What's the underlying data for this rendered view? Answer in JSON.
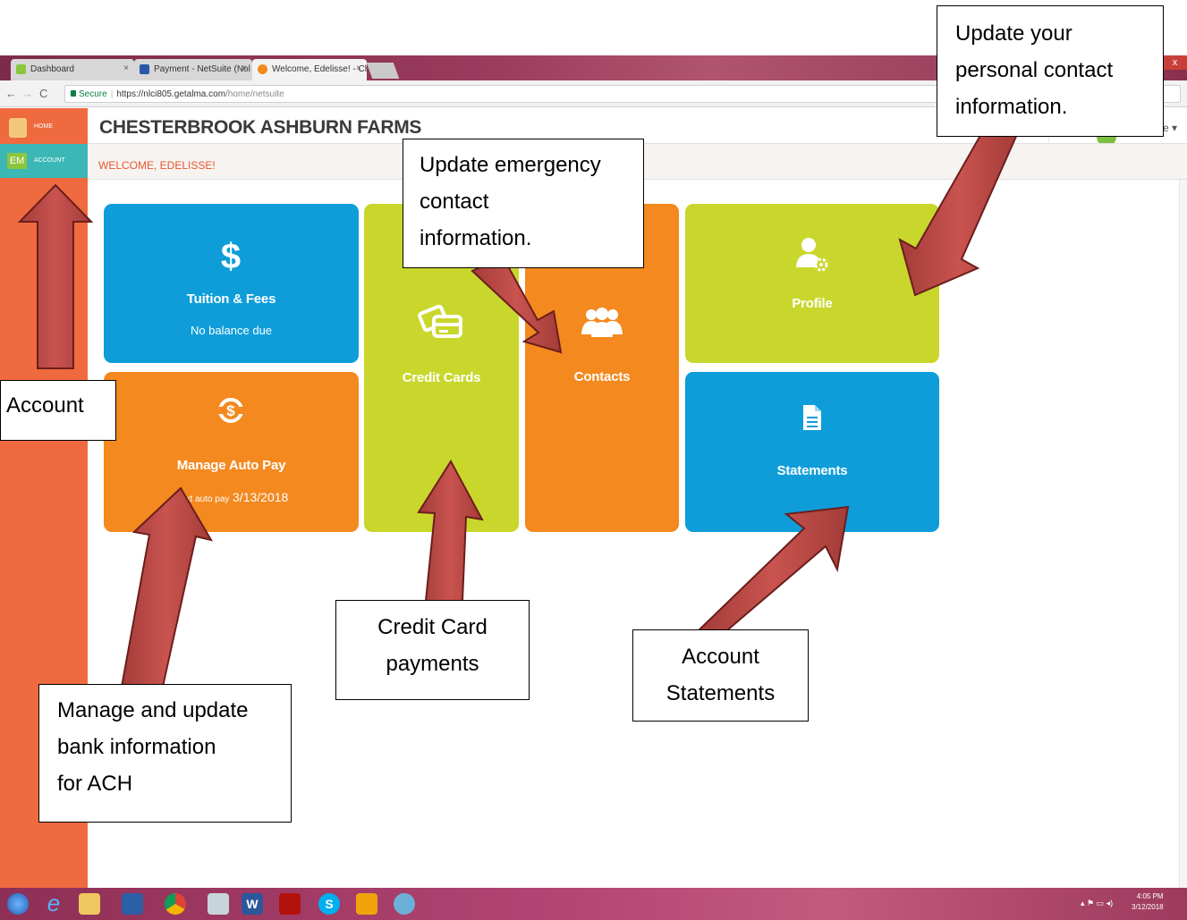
{
  "browser": {
    "tabs": [
      {
        "label": "Dashboard",
        "icon": "dashboard-tab-icon"
      },
      {
        "label": "Payment - NetSuite (Nol",
        "icon": "netsuite-tab-icon"
      },
      {
        "label": "Welcome, Edelisse! - Che",
        "icon": "almanac-tab-icon"
      }
    ],
    "tab_close": "×",
    "window_close": "x",
    "secure_label": "Secure",
    "url": "https://nlci805.getalma.com",
    "url_path": "/home/netsuite"
  },
  "sidebar": {
    "home_label": "HOME",
    "account_badge": "EM",
    "account_label": "ACCOUNT"
  },
  "header": {
    "title": "CHESTERBROOK ASHBURN FARMS",
    "welcome": "WELCOME, EDELISSE!",
    "right_fragment": "e ▾"
  },
  "tiles": {
    "tuition": {
      "title": "Tuition & Fees",
      "sub": "No balance due",
      "icon": "dollar-icon"
    },
    "autopay": {
      "title": "Manage Auto Pay",
      "sub_prefix": "Next auto pay",
      "sub_date": "3/13/2018",
      "icon": "autopay-icon"
    },
    "credit": {
      "title": "Credit Cards",
      "icon": "credit-card-icon"
    },
    "contacts": {
      "title": "Contacts",
      "icon": "people-icon"
    },
    "profile": {
      "title": "Profile",
      "icon": "user-gear-icon"
    },
    "statements": {
      "title": "Statements",
      "icon": "document-icon"
    }
  },
  "annotations": {
    "account": "Account",
    "emergency": [
      "Update emergency",
      "contact",
      "information."
    ],
    "personal": [
      "Update your",
      "personal contact",
      "information."
    ],
    "ach": [
      "Manage and update",
      "bank information",
      "for ACH"
    ],
    "credit": [
      "Credit Card",
      "payments"
    ],
    "statements": [
      "Account",
      "Statements"
    ]
  },
  "taskbar": {
    "time": "4:05 PM",
    "date": "3/12/2018"
  },
  "colors": {
    "blue": "#0e9dd9",
    "orange": "#f3891f",
    "green": "#c9d72c",
    "sidebar": "#ef6b3f",
    "arrow": "#c0504d"
  }
}
